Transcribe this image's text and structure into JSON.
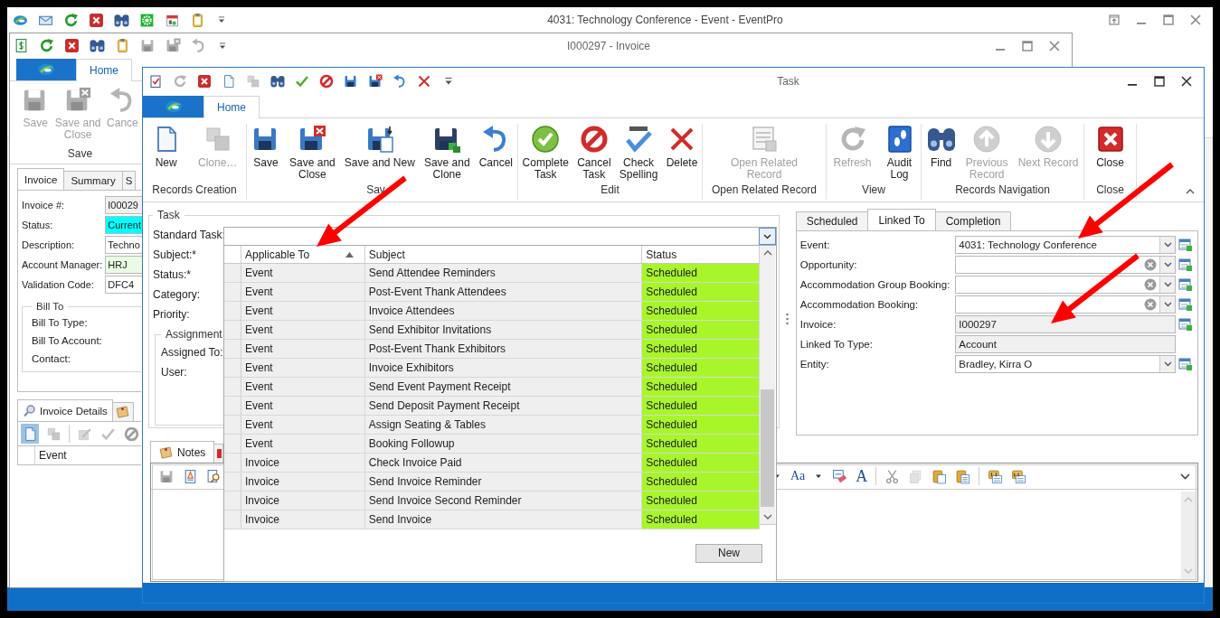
{
  "main_window": {
    "title": "4031: Technology Conference - Event - EventPro"
  },
  "invoice_window": {
    "title": "I000297 - Invoice",
    "ribbon_tabs": [
      {
        "label": "Home",
        "selected": true
      }
    ],
    "ribbon_buttons": [
      {
        "label": "Save",
        "disabled": true
      },
      {
        "label": "Save and\nClose",
        "disabled": true
      },
      {
        "label": "Cance",
        "disabled": true
      }
    ],
    "ribbon_group": "Save",
    "tabs": [
      {
        "label": "Invoice",
        "selected": true
      },
      {
        "label": "Summary",
        "selected": false
      },
      {
        "label": "S",
        "selected": false
      }
    ],
    "fields": [
      {
        "label": "Invoice #:",
        "value": "I00029",
        "color": "#f0f0f0"
      },
      {
        "label": "Status:",
        "value": "Current",
        "color": "#00ffff"
      },
      {
        "label": "Description:",
        "value": "Techno",
        "color": "#ffffff"
      },
      {
        "label": "Account Manager:",
        "value": "HRJ",
        "color": "#e9fbe3"
      },
      {
        "label": "Validation Code:",
        "value": "DFC4",
        "color": "#ffffff"
      }
    ],
    "bill_to": {
      "title": "Bill To",
      "labels": [
        "Bill To Type:",
        "Bill To Account:",
        "Contact:"
      ]
    },
    "detail_tabs": [
      {
        "label": "Invoice Details",
        "selected": true
      },
      {
        "selected": false
      }
    ],
    "detail_toolbar": [
      {
        "selected": true,
        "disabled": false
      },
      {
        "selected": false,
        "disabled": true
      },
      {
        "selected": false,
        "disabled": true
      },
      {
        "selected": false,
        "disabled": true
      },
      {
        "selected": false,
        "disabled": true
      }
    ],
    "grid_columns": [
      "Event"
    ]
  },
  "task_window": {
    "title": "Task",
    "ribbon_tabs": [
      {
        "label": "Home",
        "selected": true
      }
    ],
    "ribbon_groups": [
      {
        "label": "Records Creation",
        "buttons": [
          {
            "label": "New",
            "disabled": false
          },
          {
            "label": "Clone…",
            "disabled": true
          }
        ]
      },
      {
        "label": "Sav",
        "buttons": [
          {
            "label": "Save",
            "disabled": false
          },
          {
            "label": "Save and\nClose",
            "disabled": false
          },
          {
            "label": "Save and New",
            "disabled": false
          },
          {
            "label": "Save and\nClone",
            "disabled": false
          },
          {
            "label": "Cancel",
            "disabled": false
          }
        ]
      },
      {
        "label": "Edit",
        "buttons": [
          {
            "label": "Complete\nTask",
            "disabled": false
          },
          {
            "label": "Cancel\nTask",
            "disabled": false
          },
          {
            "label": "Check\nSpelling",
            "disabled": false
          },
          {
            "label": "Delete",
            "disabled": false
          }
        ]
      },
      {
        "label": "Open Related Record",
        "buttons": [
          {
            "label": "Open Related\nRecord",
            "disabled": true
          }
        ]
      },
      {
        "label": "View",
        "buttons": [
          {
            "label": "Refresh",
            "disabled": true
          },
          {
            "label": "Audit\nLog",
            "disabled": false
          }
        ]
      },
      {
        "label": "Records Navigation",
        "buttons": [
          {
            "label": "Find",
            "disabled": false
          },
          {
            "label": "Previous\nRecord",
            "disabled": true
          },
          {
            "label": "Next Record",
            "disabled": true
          }
        ]
      },
      {
        "label": "Close",
        "buttons": [
          {
            "label": "Close",
            "disabled": false
          }
        ]
      }
    ],
    "task_group": {
      "title": "Task",
      "labels": [
        "Standard Task:",
        "Subject:*",
        "Status:*",
        "Category:",
        "Priority:"
      ],
      "assignment": {
        "title": "Assignment",
        "labels": [
          "Assigned To:",
          "User:"
        ]
      }
    },
    "link_tabs": [
      {
        "label": "Scheduled",
        "selected": false
      },
      {
        "label": "Linked To",
        "selected": true
      },
      {
        "label": "Completion",
        "selected": false
      }
    ],
    "link_fields": [
      {
        "label": "Event:",
        "value": "4031: Technology Conference",
        "read_only": false,
        "clear_button": false,
        "dropdown_button": true,
        "lookup_button": true
      },
      {
        "label": "Opportunity:",
        "read_only": false,
        "clear_button": true,
        "dropdown_button": true,
        "lookup_button": true
      },
      {
        "label": "Accommodation Group Booking:",
        "read_only": false,
        "clear_button": true,
        "dropdown_button": true,
        "lookup_button": true
      },
      {
        "label": "Accommodation Booking:",
        "read_only": false,
        "clear_button": true,
        "dropdown_button": true,
        "lookup_button": true
      },
      {
        "label": "Invoice:",
        "value": "I000297",
        "read_only": true,
        "clear_button": false,
        "dropdown_button": false,
        "lookup_button": true
      },
      {
        "label": "Linked To Type:",
        "value": "Account",
        "read_only": true,
        "clear_button": false,
        "dropdown_button": false,
        "lookup_button": false
      },
      {
        "label": "Entity:",
        "value": "Bradley, Kirra O",
        "read_only": false,
        "clear_button": false,
        "dropdown_button": true,
        "lookup_button": true
      }
    ],
    "notes_tabs": [
      {
        "label": "Notes",
        "selected": true
      },
      {
        "selected": false
      }
    ],
    "notes_toolbar": {
      "font_size_button": "Aa",
      "font_button": "A"
    },
    "standard_task_dropdown": {
      "columns": [
        {
          "label": "Applicable To",
          "sorted": true
        },
        {
          "label": "Subject",
          "sorted": false
        },
        {
          "label": "Status",
          "sorted": false
        }
      ],
      "rows": [
        {
          "applicable_to": "Event",
          "subject": "Send Attendee Reminders",
          "status": "Scheduled"
        },
        {
          "applicable_to": "Event",
          "subject": "Post-Event Thank Attendees",
          "status": "Scheduled"
        },
        {
          "applicable_to": "Event",
          "subject": "Invoice Attendees",
          "status": "Scheduled"
        },
        {
          "applicable_to": "Event",
          "subject": "Send Exhibitor Invitations",
          "status": "Scheduled"
        },
        {
          "applicable_to": "Event",
          "subject": "Post-Event Thank Exhibitors",
          "status": "Scheduled"
        },
        {
          "applicable_to": "Event",
          "subject": "Invoice Exhibitors",
          "status": "Scheduled"
        },
        {
          "applicable_to": "Event",
          "subject": "Send Event Payment Receipt",
          "status": "Scheduled"
        },
        {
          "applicable_to": "Event",
          "subject": "Send Deposit Payment Receipt",
          "status": "Scheduled"
        },
        {
          "applicable_to": "Event",
          "subject": "Assign Seating & Tables",
          "status": "Scheduled"
        },
        {
          "applicable_to": "Event",
          "subject": "Booking Followup",
          "status": "Scheduled"
        },
        {
          "applicable_to": "Invoice",
          "subject": "Check Invoice Paid",
          "status": "Scheduled"
        },
        {
          "applicable_to": "Invoice",
          "subject": "Send Invoice Reminder",
          "status": "Scheduled"
        },
        {
          "applicable_to": "Invoice",
          "subject": "Send Invoice Second Reminder",
          "status": "Scheduled"
        },
        {
          "applicable_to": "Invoice",
          "subject": "Send Invoice",
          "status": "Scheduled"
        }
      ],
      "new_button": "New"
    }
  }
}
